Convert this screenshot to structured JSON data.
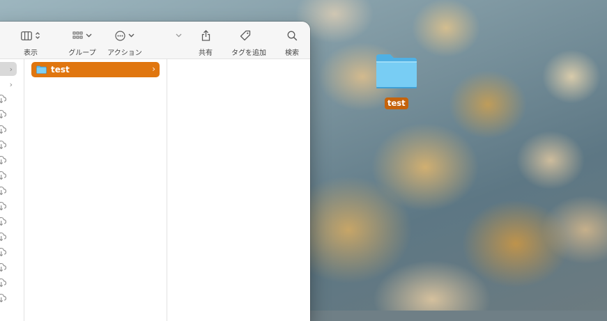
{
  "toolbar": {
    "view": {
      "label": "表示",
      "icon": "column-view-icon"
    },
    "group": {
      "label": "グループ",
      "icon": "group-grid-icon"
    },
    "action": {
      "label": "アクション",
      "icon": "ellipsis-circle-icon"
    },
    "more": {
      "icon": "chevron-down-icon"
    },
    "share": {
      "label": "共有",
      "icon": "share-icon"
    },
    "tag": {
      "label": "タグを追加",
      "icon": "tag-icon"
    },
    "search": {
      "label": "検索",
      "icon": "search-icon"
    }
  },
  "sidebar_rows": {
    "expandable": [
      "›",
      "›"
    ],
    "cloud_count": 14
  },
  "column": {
    "items": [
      {
        "name": "test",
        "icon": "folder-icon",
        "selected": true,
        "has_children": true,
        "chevron": "›"
      }
    ]
  },
  "desktop": {
    "icons": [
      {
        "label": "test",
        "icon": "folder-icon",
        "selected": true
      }
    ]
  },
  "colors": {
    "selection": "#e0760f",
    "desktop_label": "#c5630c",
    "folder": "#6ec4ef"
  }
}
